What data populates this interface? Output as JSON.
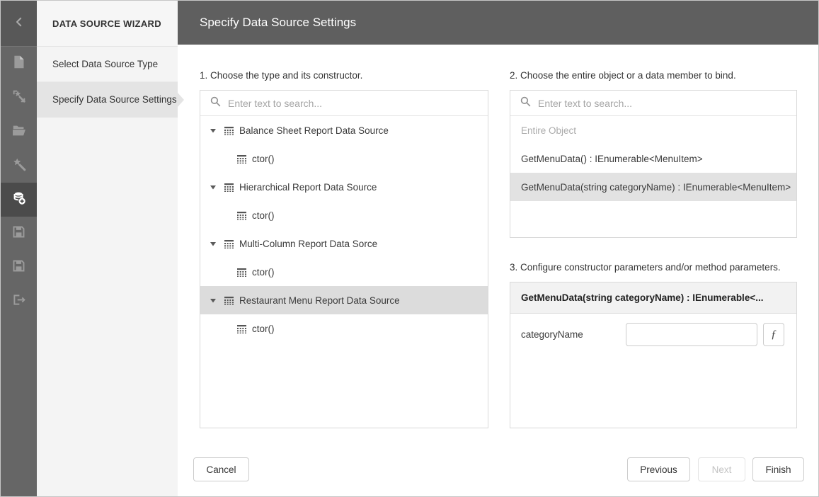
{
  "window": {
    "header_title": "Specify Data Source Settings"
  },
  "colors": {
    "rail_bg": "#666666",
    "rail_active_bg": "#4b4b4b",
    "rail_icon": "#9e9e9e",
    "header_bg": "#5f5f5f",
    "nav_bg": "#f4f4f4",
    "nav_selected_bg": "#e4e4e4",
    "selected_row_bg": "#dcdcdc",
    "border": "#d9d9d9",
    "text": "#333333",
    "placeholder": "#a4a4a4"
  },
  "rail": {
    "icons": [
      {
        "name": "back-chevron-icon",
        "active": false
      },
      {
        "name": "new-report-icon",
        "active": false
      },
      {
        "name": "report-wizard-icon",
        "active": false
      },
      {
        "name": "open-report-icon",
        "active": false
      },
      {
        "name": "design-wizard-icon",
        "active": false
      },
      {
        "name": "add-data-source-icon",
        "active": true
      },
      {
        "name": "save-icon",
        "active": false
      },
      {
        "name": "save-as-icon",
        "active": false
      },
      {
        "name": "exit-icon",
        "active": false
      }
    ]
  },
  "wizard_nav": {
    "title": "DATA SOURCE WIZARD",
    "steps": [
      {
        "label": "Select Data Source Type",
        "selected": false
      },
      {
        "label": "Specify Data Source Settings",
        "selected": true
      }
    ]
  },
  "panel1": {
    "heading": "1. Choose the type and its constructor.",
    "search_placeholder": "Enter text to search...",
    "tree": [
      {
        "label": "Balance Sheet Report Data Source",
        "level": 0,
        "expanded": true,
        "selected": false
      },
      {
        "label": "ctor()",
        "level": 1,
        "selected": false
      },
      {
        "label": "Hierarchical Report Data Source",
        "level": 0,
        "expanded": true,
        "selected": false
      },
      {
        "label": "ctor()",
        "level": 1,
        "selected": false
      },
      {
        "label": "Multi-Column Report Data Sorce",
        "level": 0,
        "expanded": true,
        "selected": false
      },
      {
        "label": "ctor()",
        "level": 1,
        "selected": false
      },
      {
        "label": "Restaurant Menu Report Data Source",
        "level": 0,
        "expanded": true,
        "selected": true
      },
      {
        "label": "ctor()",
        "level": 1,
        "selected": false
      }
    ]
  },
  "panel2": {
    "heading": "2. Choose the entire object or a data member to bind.",
    "search_placeholder": "Enter text to search...",
    "items": [
      {
        "label": "Entire Object",
        "muted": true,
        "selected": false
      },
      {
        "label": "GetMenuData() : IEnumerable<MenuItem>",
        "muted": false,
        "selected": false
      },
      {
        "label": "GetMenuData(string categoryName) : IEnumerable<MenuItem>",
        "muted": false,
        "selected": true
      }
    ]
  },
  "panel3": {
    "heading": "3. Configure constructor parameters and/or method parameters.",
    "grid_header": "GetMenuData(string categoryName) : IEnumerable<...",
    "params": [
      {
        "name": "categoryName",
        "value": "",
        "fx_label": "ƒ"
      }
    ]
  },
  "footer": {
    "cancel_label": "Cancel",
    "previous_label": "Previous",
    "next_label": "Next",
    "next_disabled": true,
    "finish_label": "Finish"
  }
}
